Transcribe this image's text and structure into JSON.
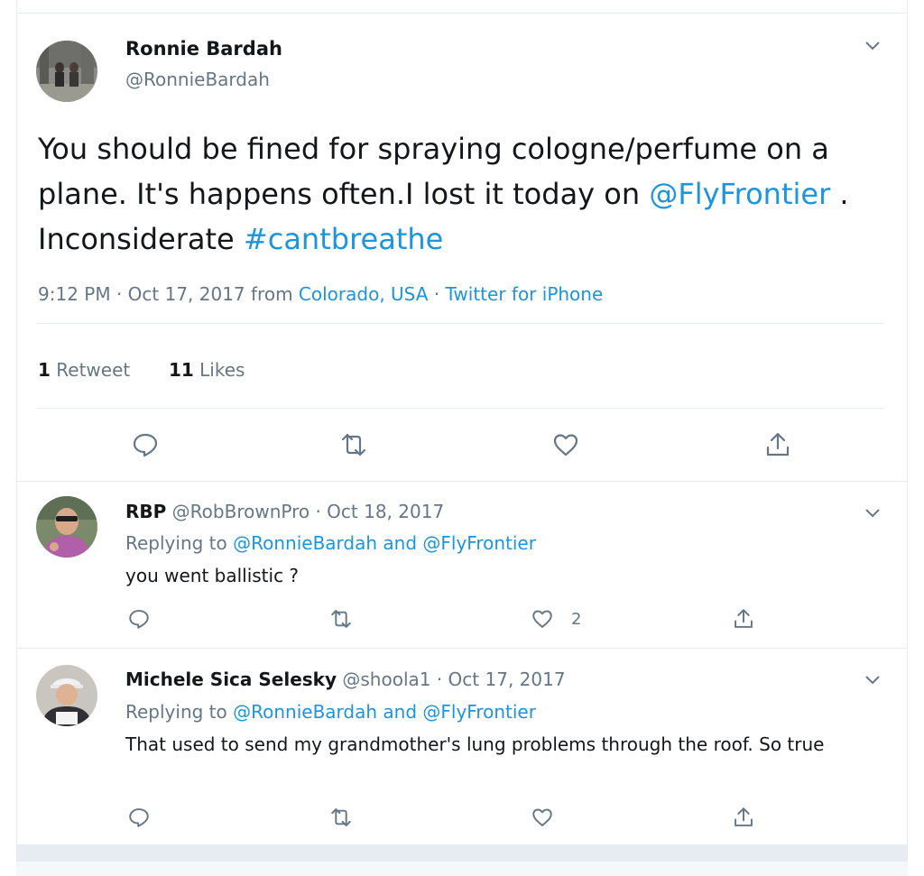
{
  "main_tweet": {
    "name": "Ronnie Bardah",
    "handle": "@RonnieBardah",
    "text_part1": "You should be fined for spraying cologne/perfume on a plane. It's happens often.I lost it today on ",
    "mention": "@FlyFrontier",
    "text_part2": " . Inconsiderate ",
    "hashtag": "#cantbreathe",
    "time": "9:12 PM · Oct 17, 2017 from ",
    "location": "Colorado, USA",
    "sep": " · ",
    "source": "Twitter for iPhone",
    "retweet_count": "1",
    "retweet_label": " Retweet",
    "like_count": "11",
    "like_label": " Likes"
  },
  "replies": [
    {
      "name": "RBP",
      "handle": " @RobBrownPro · Oct 18, 2017",
      "replying_label": "Replying to ",
      "replying_users": "@RonnieBardah and @FlyFrontier",
      "text": "you went ballistic ?",
      "like_count": "2"
    },
    {
      "name": "Michele Sica Selesky",
      "handle": " @shoola1 · Oct 17, 2017",
      "replying_label": "Replying to ",
      "replying_users": "@RonnieBardah and @FlyFrontier",
      "text": "That used to send my grandmother's lung problems through the roof. So true",
      "like_count": ""
    }
  ],
  "colors": {
    "link": "#1b95e0",
    "muted": "#657786",
    "text": "#14171a",
    "border": "#e6ecf0"
  },
  "icons": [
    "chevron-down-icon",
    "reply-icon",
    "retweet-icon",
    "like-icon",
    "share-icon"
  ]
}
